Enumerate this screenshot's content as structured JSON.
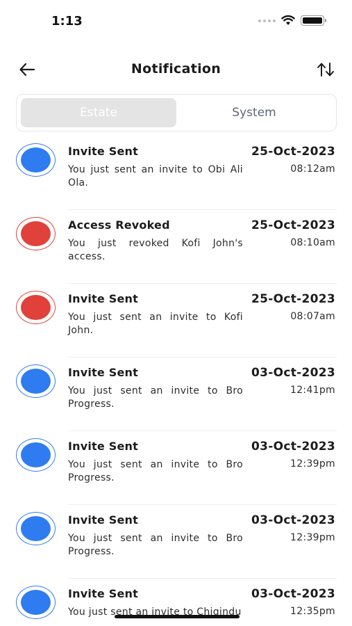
{
  "status_bar": {
    "time": "1:13",
    "icons": [
      "signal-dots-icon",
      "wifi-icon",
      "battery-icon"
    ]
  },
  "header": {
    "title": "Notification",
    "back_icon": "arrow-left-icon",
    "sort_icon": "sort-arrows-icon"
  },
  "tabs": [
    {
      "label": "Estate",
      "active": true
    },
    {
      "label": "System",
      "active": false
    }
  ],
  "colors": {
    "blue": "#2f7cf0",
    "red": "#e0413a",
    "active_tab_bg": "#e4e4e4",
    "inactive_tab_text": "#5b6577"
  },
  "notifications": [
    {
      "title": "Invite Sent",
      "description": "You just sent an invite to Obi Ali Ola.",
      "date": "25-Oct-2023",
      "time": "08:12am",
      "status": "blue"
    },
    {
      "title": "Access Revoked",
      "description": "You just revoked Kofi John's access.",
      "date": "25-Oct-2023",
      "time": "08:10am",
      "status": "red"
    },
    {
      "title": "Invite Sent",
      "description": "You just sent an invite to Kofi John.",
      "date": "25-Oct-2023",
      "time": "08:07am",
      "status": "red"
    },
    {
      "title": "Invite Sent",
      "description": "You just sent an invite to Bro Progress.",
      "date": "03-Oct-2023",
      "time": "12:41pm",
      "status": "blue"
    },
    {
      "title": "Invite Sent",
      "description": "You just sent an invite to Bro Progress.",
      "date": "03-Oct-2023",
      "time": "12:39pm",
      "status": "blue"
    },
    {
      "title": "Invite Sent",
      "description": "You just sent an invite to Bro Progress.",
      "date": "03-Oct-2023",
      "time": "12:39pm",
      "status": "blue"
    },
    {
      "title": "Invite Sent",
      "description": "You just sent an invite to Chigindu",
      "date": "03-Oct-2023",
      "time": "12:35pm",
      "status": "blue"
    }
  ]
}
